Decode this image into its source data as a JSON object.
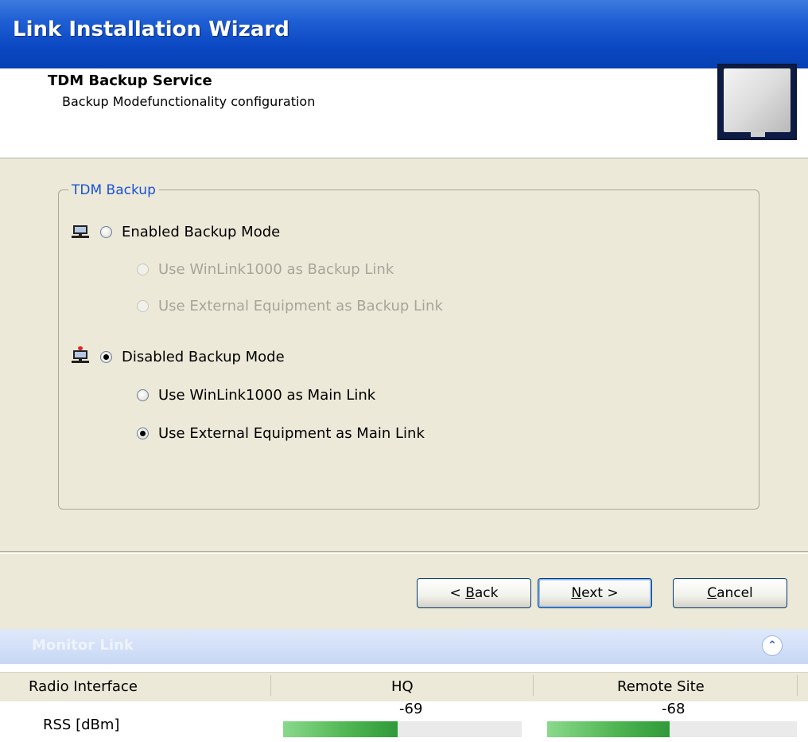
{
  "window": {
    "title": "Link Installation Wizard"
  },
  "header": {
    "title": "TDM Backup Service",
    "subtitle": "Backup Modefunctionality configuration"
  },
  "group": {
    "legend": "TDM Backup",
    "options": {
      "enabled_mode": {
        "label": "Enabled Backup Mode",
        "checked": false
      },
      "backup_winlink": {
        "label": "Use WinLink1000 as Backup Link",
        "disabled": true
      },
      "backup_external": {
        "label": "Use External Equipment as Backup Link",
        "disabled": true
      },
      "disabled_mode": {
        "label": "Disabled Backup Mode",
        "checked": true
      },
      "main_winlink": {
        "label": "Use WinLink1000 as Main Link",
        "checked": false
      },
      "main_external": {
        "label": "Use External Equipment as Main Link",
        "checked": true
      }
    }
  },
  "buttons": {
    "back": "< Back",
    "next": "Next >",
    "cancel": "Cancel"
  },
  "monitor": {
    "label": "Monitor Link",
    "columns": [
      "Radio Interface",
      "HQ",
      "Remote Site"
    ],
    "rss": {
      "label": "RSS [dBm]",
      "hq": "-69",
      "remote": "-68",
      "hq_level": 0.48,
      "remote_level": 0.49
    }
  },
  "icons": {
    "mode_icon": "network-monitor-icon",
    "collapse": "double-chevron-up-icon"
  }
}
